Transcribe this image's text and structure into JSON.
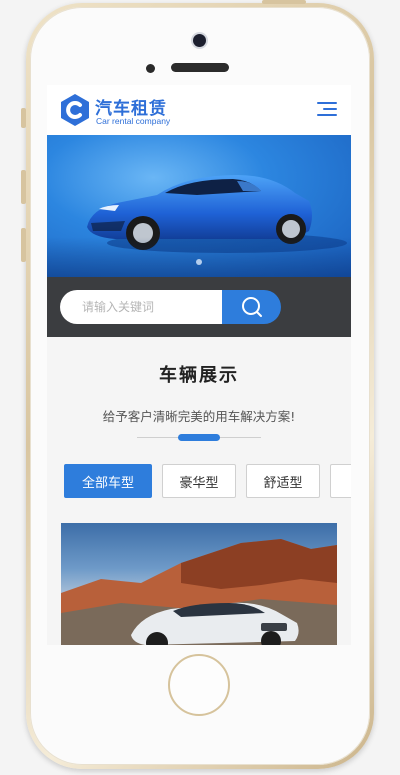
{
  "header": {
    "logo_text": "汽车租赁",
    "logo_sub": "Car rental company"
  },
  "search": {
    "placeholder": "请输入关键词"
  },
  "section": {
    "title": "车辆展示",
    "subtitle": "给予客户清晰完美的用车解决方案!"
  },
  "tabs": [
    {
      "label": "全部车型",
      "active": true
    },
    {
      "label": "豪华型",
      "active": false
    },
    {
      "label": "舒适型",
      "active": false
    }
  ],
  "colors": {
    "accent": "#2e7ddc",
    "brand": "#2e6fd8",
    "search_bg": "#3b3d40"
  },
  "icons": {
    "menu": "menu-icon",
    "search": "search-icon",
    "logo": "logo-c-icon"
  }
}
